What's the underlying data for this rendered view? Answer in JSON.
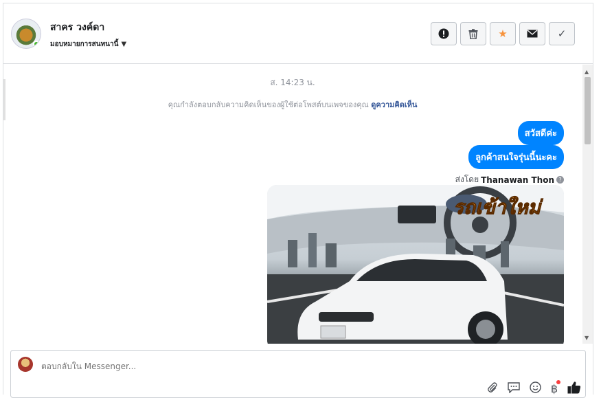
{
  "header": {
    "contact_name": "สาคร วงค์ดา",
    "assign_label": "มอบหมายการสนทนานี้",
    "actions": [
      {
        "name": "report-spam-button",
        "icon": "exclamation-icon",
        "glyph": "!"
      },
      {
        "name": "delete-button",
        "icon": "trash-icon",
        "glyph": "🗑"
      },
      {
        "name": "star-button",
        "icon": "star-icon",
        "glyph": "★"
      },
      {
        "name": "mark-unread-button",
        "icon": "envelope-icon",
        "glyph": "✉"
      },
      {
        "name": "mark-done-button",
        "icon": "checkmark-icon",
        "glyph": "✓"
      }
    ]
  },
  "chat": {
    "timestamp": "ส. 14:23 น.",
    "reply_note": "คุณกำลังตอบกลับความคิดเห็นของผู้ใช้ต่อโพสต์บนเพจของคุณ",
    "reply_note_link": "ดูความคิดเห็น",
    "messages": [
      {
        "text": "สวัสดีค่ะ"
      },
      {
        "text": "ลูกค้าสนใจรุ่นนี้นะคะ"
      }
    ],
    "sent_by_label": "ส่งโดย",
    "sent_by_name": "Thanawan Thon",
    "image_caption": "รถเข้าใหม่"
  },
  "composer": {
    "placeholder": "ตอบกลับใน Messenger...",
    "tools": [
      "attachment-icon",
      "saved-reply-icon",
      "emoji-icon",
      "baht-payment-icon",
      "thumbs-up-icon"
    ]
  },
  "colors": {
    "accent": "#0084ff",
    "star": "#f7923b",
    "link": "#365899"
  }
}
